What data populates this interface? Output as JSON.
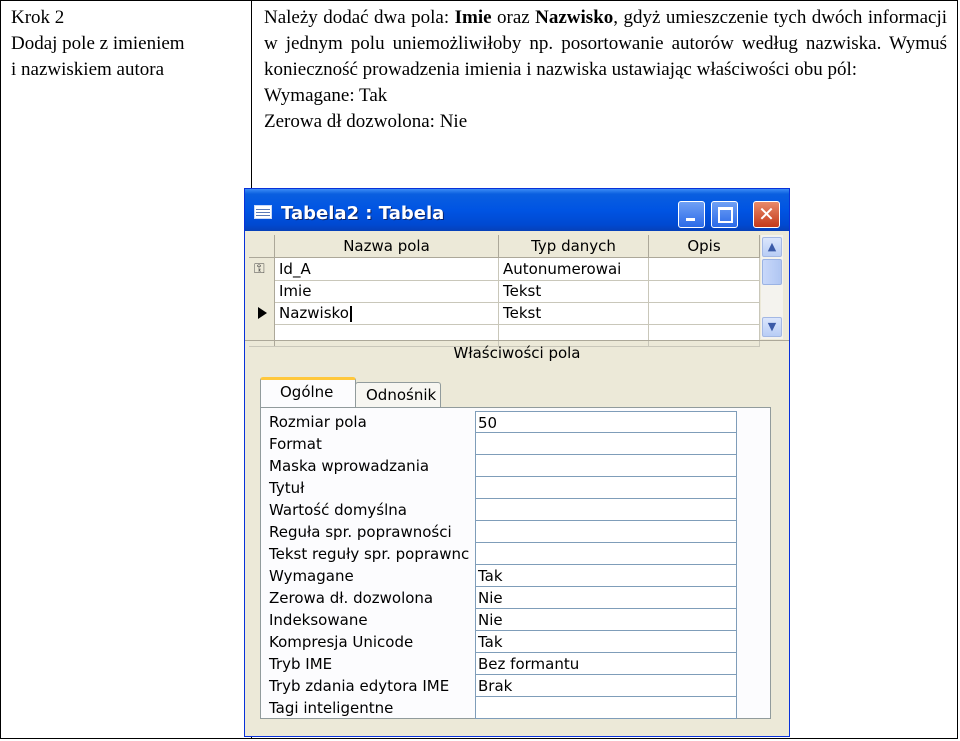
{
  "step": {
    "number": "Krok 2",
    "line1": "Dodaj pole z imieniem",
    "line2": "i nazwiskiem autora"
  },
  "description": {
    "part1": "Należy dodać dwa pola: ",
    "bold1": "Imie",
    "part2": " oraz ",
    "bold2": "Nazwisko",
    "part3": ", gdyż umieszczenie tych dwóch informacji w jednym polu uniemożliwiłoby np. posortowanie autorów według nazwiska. Wymuś konieczność prowadzenia imienia i nazwiska ustawiając właściwości obu pól:",
    "required_line": "Wymagane: Tak",
    "zero_length_line": "Zerowa dł dozwolona: Nie"
  },
  "window": {
    "title": "Tabela2 : Tabela",
    "grid": {
      "headers": {
        "name": "Nazwa pola",
        "type": "Typ danych",
        "description": "Opis"
      },
      "rows": [
        {
          "name": "Id_A",
          "type": "Autonumerowai",
          "description": "",
          "key": true
        },
        {
          "name": "Imie",
          "type": "Tekst",
          "description": ""
        },
        {
          "name": "Nazwisko",
          "type": "Tekst",
          "description": "",
          "current": true
        },
        {
          "name": "",
          "type": "",
          "description": ""
        }
      ]
    },
    "properties_title": "Właściwości pola",
    "tabs": {
      "general": "Ogólne",
      "lookup": "Odnośnik"
    },
    "properties": [
      {
        "label": "Rozmiar pola",
        "value": "50"
      },
      {
        "label": "Format",
        "value": ""
      },
      {
        "label": "Maska wprowadzania",
        "value": ""
      },
      {
        "label": "Tytuł",
        "value": ""
      },
      {
        "label": "Wartość domyślna",
        "value": ""
      },
      {
        "label": "Reguła spr. poprawności",
        "value": ""
      },
      {
        "label": "Tekst reguły spr. poprawnc",
        "value": ""
      },
      {
        "label": "Wymagane",
        "value": "Tak"
      },
      {
        "label": "Zerowa dł. dozwolona",
        "value": "Nie"
      },
      {
        "label": "Indeksowane",
        "value": "Nie"
      },
      {
        "label": "Kompresja Unicode",
        "value": "Tak"
      },
      {
        "label": "Tryb IME",
        "value": "Bez formantu"
      },
      {
        "label": "Tryb zdania edytora IME",
        "value": "Brak"
      },
      {
        "label": "Tagi inteligentne",
        "value": ""
      }
    ]
  }
}
